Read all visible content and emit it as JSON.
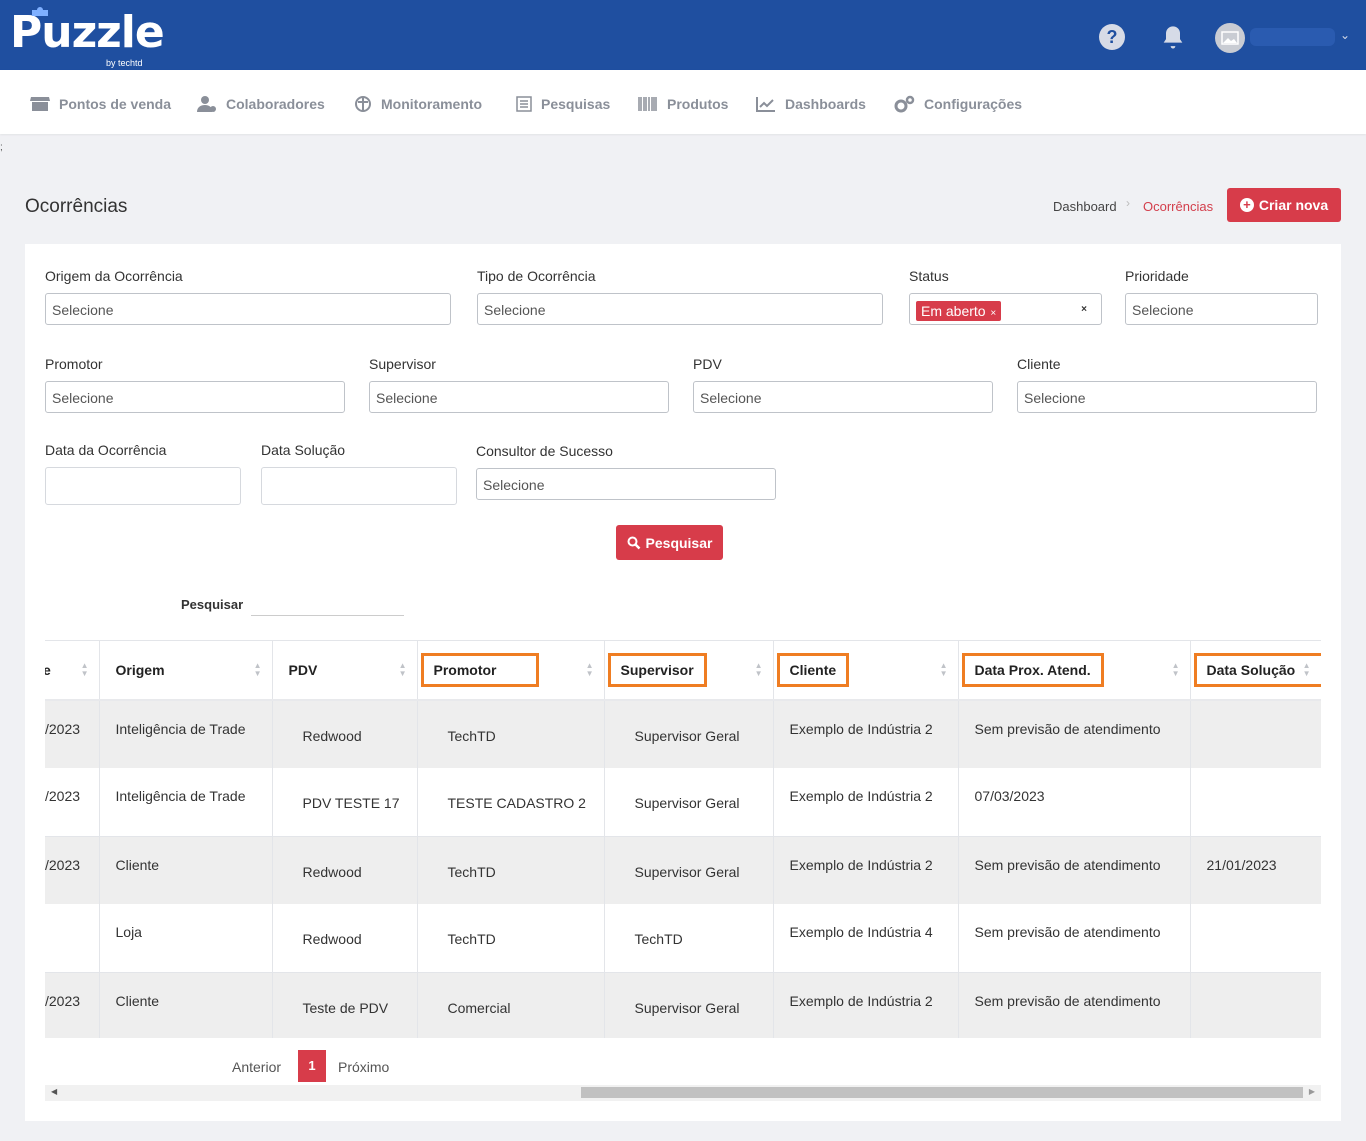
{
  "brand": {
    "name": "Puzzle",
    "byline": "by techtd"
  },
  "topbar": {
    "help_label": "?"
  },
  "nav": [
    {
      "label": "Pontos de venda",
      "icon": "store-icon"
    },
    {
      "label": "Colaboradores",
      "icon": "users-gear-icon"
    },
    {
      "label": "Monitoramento",
      "icon": "monitor-icon"
    },
    {
      "label": "Pesquisas",
      "icon": "survey-icon"
    },
    {
      "label": "Produtos",
      "icon": "barcode-icon"
    },
    {
      "label": "Dashboards",
      "icon": "chart-line-icon"
    },
    {
      "label": "Configurações",
      "icon": "gears-icon"
    }
  ],
  "stray_char": ";",
  "page": {
    "title": "Ocorrências",
    "breadcrumb": {
      "home": "Dashboard",
      "current": "Ocorrências"
    },
    "create_label": "Criar nova"
  },
  "filters": {
    "origem": {
      "label": "Origem da Ocorrência",
      "value": "Selecione"
    },
    "tipo": {
      "label": "Tipo de Ocorrência",
      "value": "Selecione"
    },
    "status": {
      "label": "Status",
      "chip": "Em aberto"
    },
    "prioridade": {
      "label": "Prioridade",
      "value": "Selecione"
    },
    "promotor": {
      "label": "Promotor",
      "value": "Selecione"
    },
    "supervisor": {
      "label": "Supervisor",
      "value": "Selecione"
    },
    "pdv": {
      "label": "PDV",
      "value": "Selecione"
    },
    "cliente": {
      "label": "Cliente",
      "value": "Selecione"
    },
    "data_ocorrencia": {
      "label": "Data da Ocorrência"
    },
    "data_solucao": {
      "label": "Data Solução"
    },
    "consultor": {
      "label": "Consultor de Sucesso",
      "value": "Selecione"
    },
    "search_button": "Pesquisar"
  },
  "table_search_label": "Pesquisar",
  "table": {
    "columns": [
      "e",
      "Origem",
      "PDV",
      "Promotor",
      "Supervisor",
      "Cliente",
      "Data Prox. Atend.",
      "Data Solução"
    ],
    "rows": [
      [
        "/2023",
        "Inteligência de Trade",
        "Redwood",
        "TechTD",
        "Supervisor Geral",
        "Exemplo de Indústria 2",
        "Sem previsão de atendimento",
        ""
      ],
      [
        "/2023",
        "Inteligência de Trade",
        "PDV TESTE 17",
        "TESTE CADASTRO 2",
        "Supervisor Geral",
        "Exemplo de Indústria 2",
        "07/03/2023",
        ""
      ],
      [
        "/2023",
        "Cliente",
        "Redwood",
        "TechTD",
        "Supervisor Geral",
        "Exemplo de Indústria 2",
        "Sem previsão de atendimento",
        "21/01/2023"
      ],
      [
        "",
        "Loja",
        "Redwood",
        "TechTD",
        "TechTD",
        "Exemplo de Indústria 4",
        "Sem previsão de atendimento",
        ""
      ],
      [
        "/2023",
        "Cliente",
        "Teste de PDV",
        "Comercial",
        "Supervisor Geral",
        "Exemplo de Indústria 2",
        "Sem previsão de atendimento",
        ""
      ]
    ]
  },
  "pagination": {
    "prev": "Anterior",
    "current": "1",
    "next": "Próximo"
  },
  "colors": {
    "brand_blue": "#1f4fa0",
    "accent_red": "#d73c4a",
    "highlight_orange": "#ef7d22"
  }
}
